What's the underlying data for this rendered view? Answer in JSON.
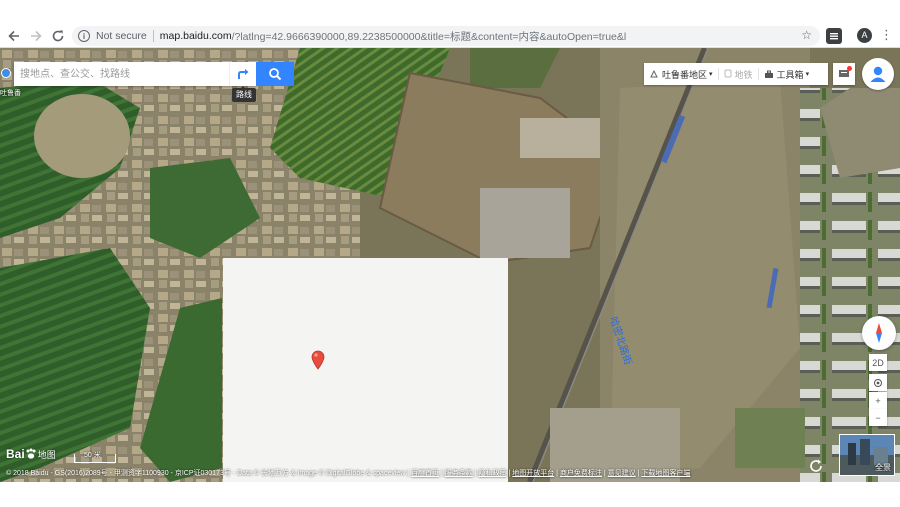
{
  "browser": {
    "security_text": "Not secure",
    "url_host": "map.baidu.com",
    "url_path": "/?latlng=42.9666390000,89.2238500000&title=标题&content=内容&autoOpen=true&l",
    "profile_initial": "A",
    "icons": [
      "back-icon",
      "forward-icon",
      "reload-icon",
      "info-icon",
      "star-icon",
      "extension-icon",
      "menu-icon"
    ]
  },
  "search": {
    "placeholder": "搜地点、查公交、找路线",
    "route_tooltip": "路线",
    "location_label": "吐鲁番"
  },
  "top_right": {
    "city": "吐鲁番地区",
    "subway": "地铁",
    "toolbox": "工具箱"
  },
  "map": {
    "road_label": "哈密北路街",
    "colors": {
      "search_button": "#3385ff",
      "marker": "#e74c3c",
      "panel": "#f4f4f2"
    }
  },
  "controls": {
    "view_2d": "2D",
    "zoom_in": "+",
    "zoom_out": "−",
    "panorama": "全景"
  },
  "footer": {
    "logo_text": "Bai",
    "logo_map": "地图",
    "scale": "50 米",
    "copyright": "© 2018 Baidu - GS(2016)2089号 - 甲测资字1100930 - 京ICP证030173号 - Data © 长地万方 & Image © DigitalGlobe & spaceview | ",
    "links": [
      "百度首页",
      "服务条款",
      "隐私政策",
      "地图开放平台",
      "商户免费标注",
      "意见建议",
      "下载地图客户端"
    ]
  }
}
